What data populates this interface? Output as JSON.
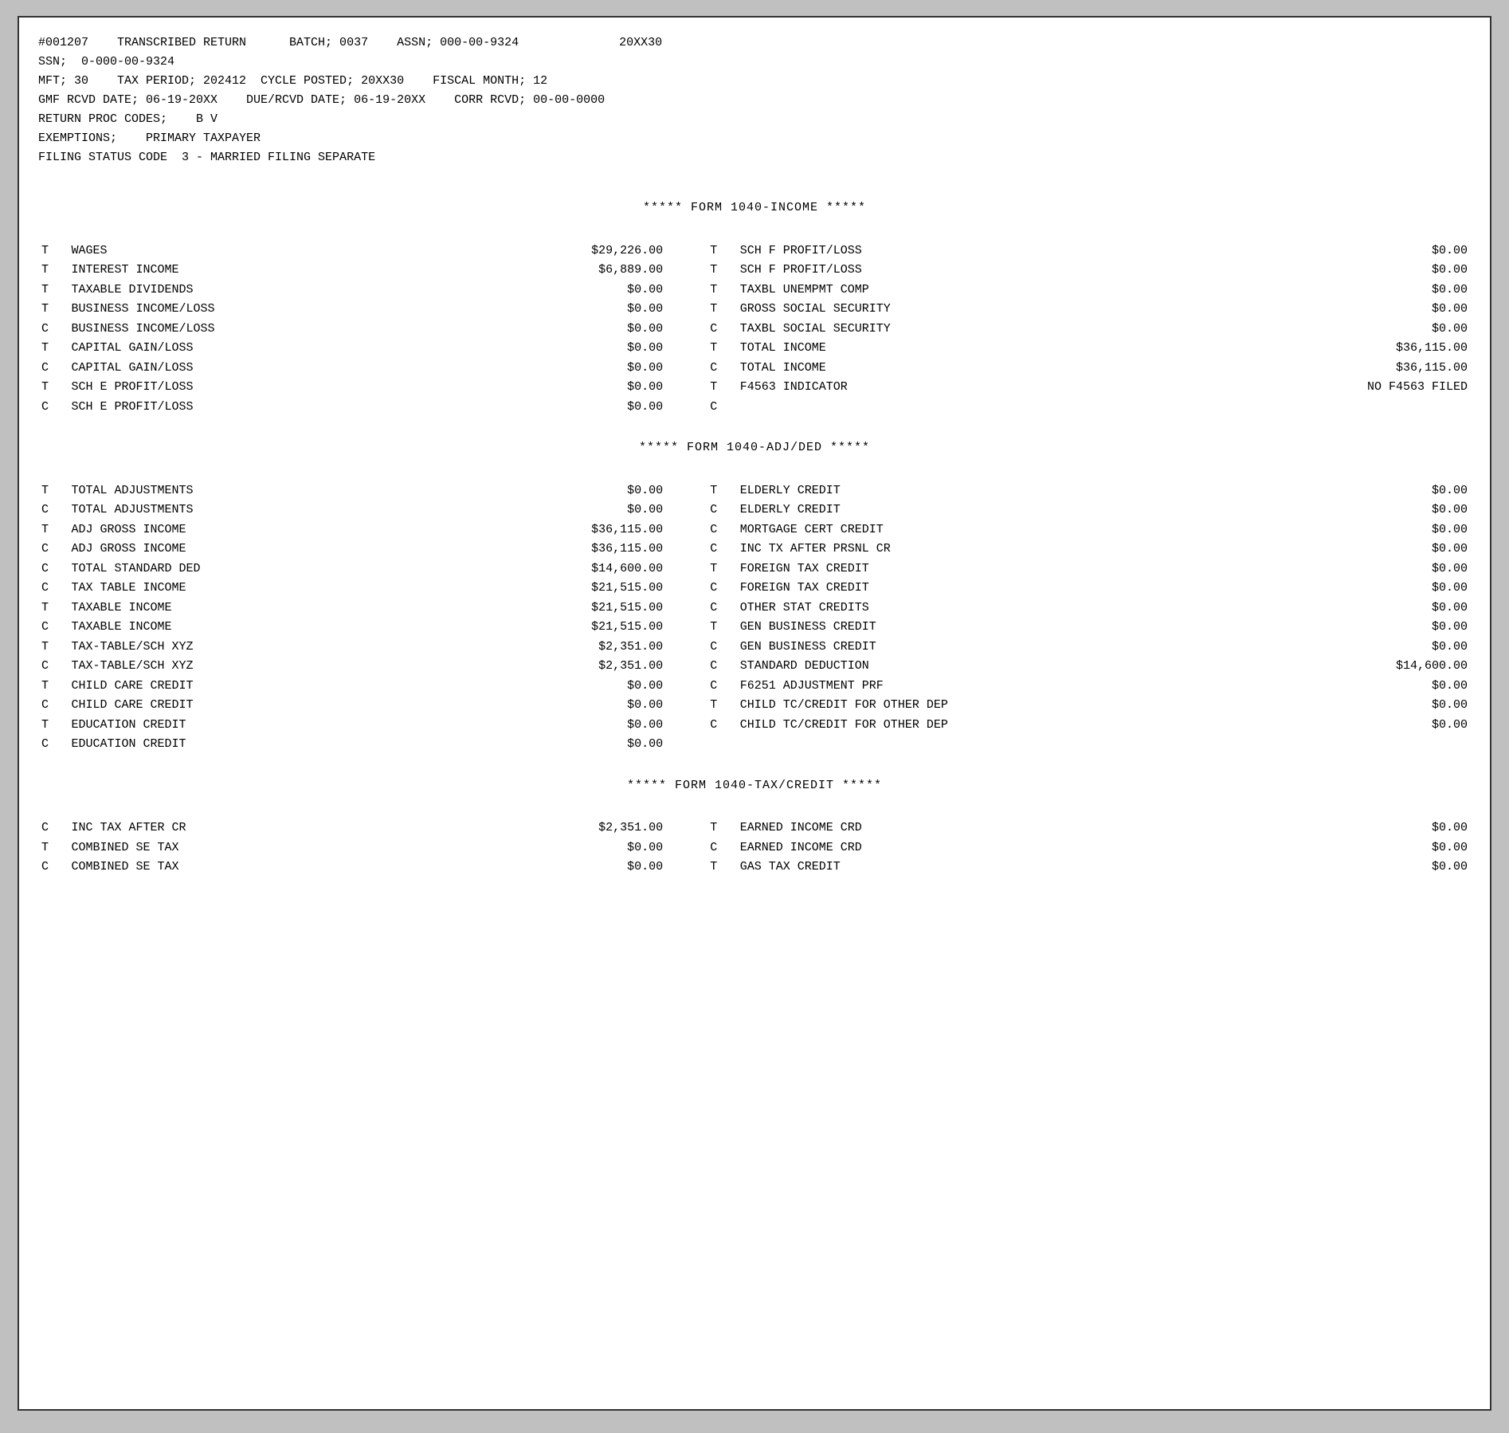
{
  "header": {
    "line1": "#001207    TRANSCRIBED RETURN      BATCH; 0037    ASSN; 000-00-9324              20XX30",
    "line2": "SSN;  0-000-00-9324",
    "line3": "MFT; 30    TAX PERIOD; 202412  CYCLE POSTED; 20XX30    FISCAL MONTH; 12",
    "line4": "GMF RCVD DATE; 06-19-20XX    DUE/RCVD DATE; 06-19-20XX    CORR RCVD; 00-00-0000",
    "line5": "RETURN PROC CODES;    B V",
    "line6": "EXEMPTIONS;    PRIMARY TAXPAYER",
    "line7": "FILING STATUS CODE  3 - MARRIED FILING SEPARATE"
  },
  "income_section": {
    "header": "*****       FORM 1040-INCOME        *****",
    "rows": [
      {
        "prefix": "T",
        "label": "WAGES",
        "value": "$29,226.00",
        "prefix2": "T",
        "label2": "SCH F PROFIT/LOSS",
        "value2": "$0.00"
      },
      {
        "prefix": "T",
        "label": "INTEREST INCOME",
        "value": "$6,889.00",
        "prefix2": "T",
        "label2": "SCH F PROFIT/LOSS",
        "value2": "$0.00"
      },
      {
        "prefix": "T",
        "label": "TAXABLE DIVIDENDS",
        "value": "$0.00",
        "prefix2": "T",
        "label2": "TAXBL UNEMPMT COMP",
        "value2": "$0.00"
      },
      {
        "prefix": "T",
        "label": "BUSINESS INCOME/LOSS",
        "value": "$0.00",
        "prefix2": "T",
        "label2": "GROSS SOCIAL SECURITY",
        "value2": "$0.00"
      },
      {
        "prefix": "C",
        "label": "BUSINESS INCOME/LOSS",
        "value": "$0.00",
        "prefix2": "C",
        "label2": "TAXBL SOCIAL SECURITY",
        "value2": "$0.00"
      },
      {
        "prefix": "T",
        "label": "CAPITAL GAIN/LOSS",
        "value": "$0.00",
        "prefix2": "T",
        "label2": "TOTAL INCOME",
        "value2": "$36,115.00"
      },
      {
        "prefix": "C",
        "label": "CAPITAL GAIN/LOSS",
        "value": "$0.00",
        "prefix2": "C",
        "label2": "TOTAL INCOME",
        "value2": "$36,115.00"
      },
      {
        "prefix": "T",
        "label": "SCH E PROFIT/LOSS",
        "value": "$0.00",
        "prefix2": "T",
        "label2": "F4563 INDICATOR",
        "value2": "NO F4563 FILED"
      },
      {
        "prefix": "C",
        "label": "SCH E PROFIT/LOSS",
        "value": "$0.00",
        "prefix2": "C",
        "label2": "",
        "value2": ""
      }
    ]
  },
  "adjded_section": {
    "header": "*****       FORM 1040-ADJ/DED        *****",
    "rows": [
      {
        "prefix": "T",
        "label": "TOTAL ADJUSTMENTS",
        "value": "$0.00",
        "prefix2": "T",
        "label2": "ELDERLY CREDIT",
        "value2": "$0.00"
      },
      {
        "prefix": "C",
        "label": "TOTAL ADJUSTMENTS",
        "value": "$0.00",
        "prefix2": "C",
        "label2": "ELDERLY CREDIT",
        "value2": "$0.00"
      },
      {
        "prefix": "T",
        "label": "ADJ GROSS INCOME",
        "value": "$36,115.00",
        "prefix2": "C",
        "label2": "MORTGAGE CERT CREDIT",
        "value2": "$0.00"
      },
      {
        "prefix": "C",
        "label": "ADJ GROSS INCOME",
        "value": "$36,115.00",
        "prefix2": "C",
        "label2": "INC TX AFTER PRSNL CR",
        "value2": "$0.00"
      },
      {
        "prefix": "C",
        "label": "TOTAL STANDARD DED",
        "value": "$14,600.00",
        "prefix2": "T",
        "label2": "FOREIGN TAX CREDIT",
        "value2": "$0.00"
      },
      {
        "prefix": "C",
        "label": "TAX TABLE INCOME",
        "value": "$21,515.00",
        "prefix2": "C",
        "label2": "FOREIGN TAX CREDIT",
        "value2": "$0.00"
      },
      {
        "prefix": "T",
        "label": "TAXABLE INCOME",
        "value": "$21,515.00",
        "prefix2": "C",
        "label2": "OTHER STAT CREDITS",
        "value2": "$0.00"
      },
      {
        "prefix": "C",
        "label": "TAXABLE INCOME",
        "value": "$21,515.00",
        "prefix2": "T",
        "label2": "GEN BUSINESS CREDIT",
        "value2": "$0.00"
      },
      {
        "prefix": "T",
        "label": "TAX-TABLE/SCH XYZ",
        "value": "$2,351.00",
        "prefix2": "C",
        "label2": "GEN BUSINESS CREDIT",
        "value2": "$0.00"
      },
      {
        "prefix": "C",
        "label": "TAX-TABLE/SCH XYZ",
        "value": "$2,351.00",
        "prefix2": "C",
        "label2": "STANDARD DEDUCTION",
        "value2": "$14,600.00"
      },
      {
        "prefix": "T",
        "label": "CHILD CARE CREDIT",
        "value": "$0.00",
        "prefix2": "C",
        "label2": "F6251 ADJUSTMENT PRF",
        "value2": "$0.00"
      },
      {
        "prefix": "C",
        "label": "CHILD CARE CREDIT",
        "value": "$0.00",
        "prefix2": "T",
        "label2": "CHILD TC/CREDIT FOR OTHER DEP",
        "value2": "$0.00"
      },
      {
        "prefix": "T",
        "label": "EDUCATION CREDIT",
        "value": "$0.00",
        "prefix2": "C",
        "label2": "CHILD TC/CREDIT FOR OTHER DEP",
        "value2": "$0.00"
      },
      {
        "prefix": "C",
        "label": "EDUCATION CREDIT",
        "value": "$0.00",
        "prefix2": "",
        "label2": "",
        "value2": ""
      }
    ]
  },
  "taxcredit_section": {
    "header": "*****       FORM 1040-TAX/CREDIT   *****",
    "rows": [
      {
        "prefix": "C",
        "label": "INC TAX AFTER CR",
        "value": "$2,351.00",
        "prefix2": "T",
        "label2": "EARNED INCOME CRD",
        "value2": "$0.00"
      },
      {
        "prefix": "T",
        "label": "COMBINED SE TAX",
        "value": "$0.00",
        "prefix2": "C",
        "label2": "EARNED INCOME CRD",
        "value2": "$0.00"
      },
      {
        "prefix": "C",
        "label": "COMBINED SE TAX",
        "value": "$0.00",
        "prefix2": "T",
        "label2": "GAS TAX CREDIT",
        "value2": "$0.00"
      }
    ]
  }
}
